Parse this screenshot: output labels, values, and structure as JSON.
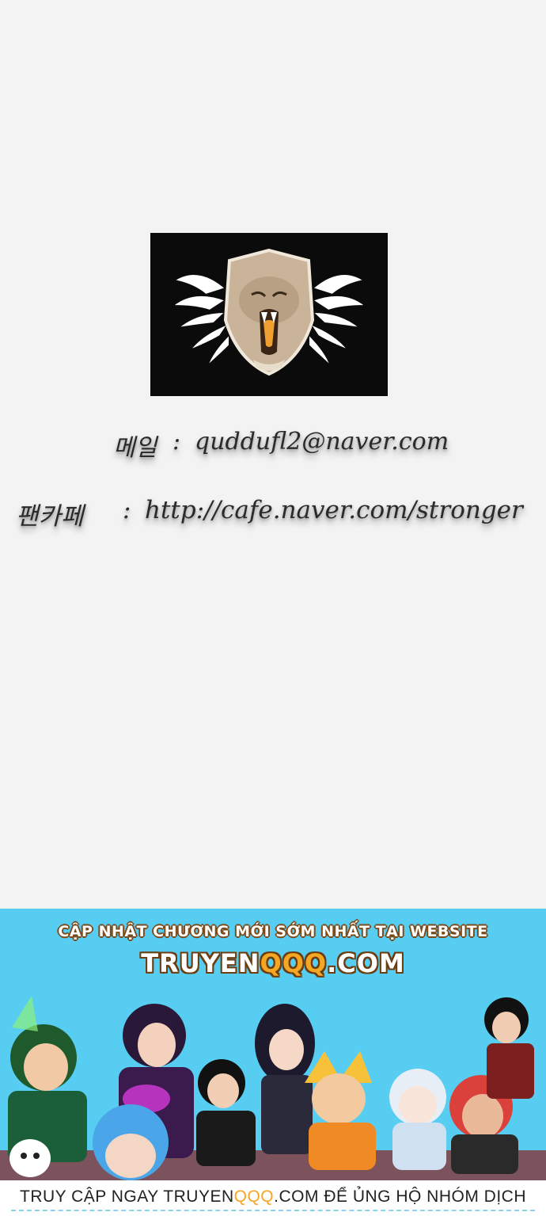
{
  "contact": {
    "email_label": "메일",
    "email_sep": ":",
    "email_value": "quddufl2@naver.com",
    "cafe_label": "팬카페",
    "cafe_sep": ":",
    "cafe_value": "http://cafe.naver.com/stronger"
  },
  "banner": {
    "headline": "CẬP NHẬT CHƯƠNG MỚI SỚM NHẤT TẠI WEBSITE",
    "site_prefix": "TRUYEN",
    "site_highlight": "QQQ",
    "site_suffix": ".COM",
    "background_color": "#57cdf2",
    "highlight_color": "#f5a623"
  },
  "footer": {
    "text_prefix": "TRUY CẬP NGAY TRUYEN",
    "text_highlight": "QQQ",
    "text_suffix": ".COM ĐỂ ỦNG HỘ NHÓM DỊCH"
  }
}
